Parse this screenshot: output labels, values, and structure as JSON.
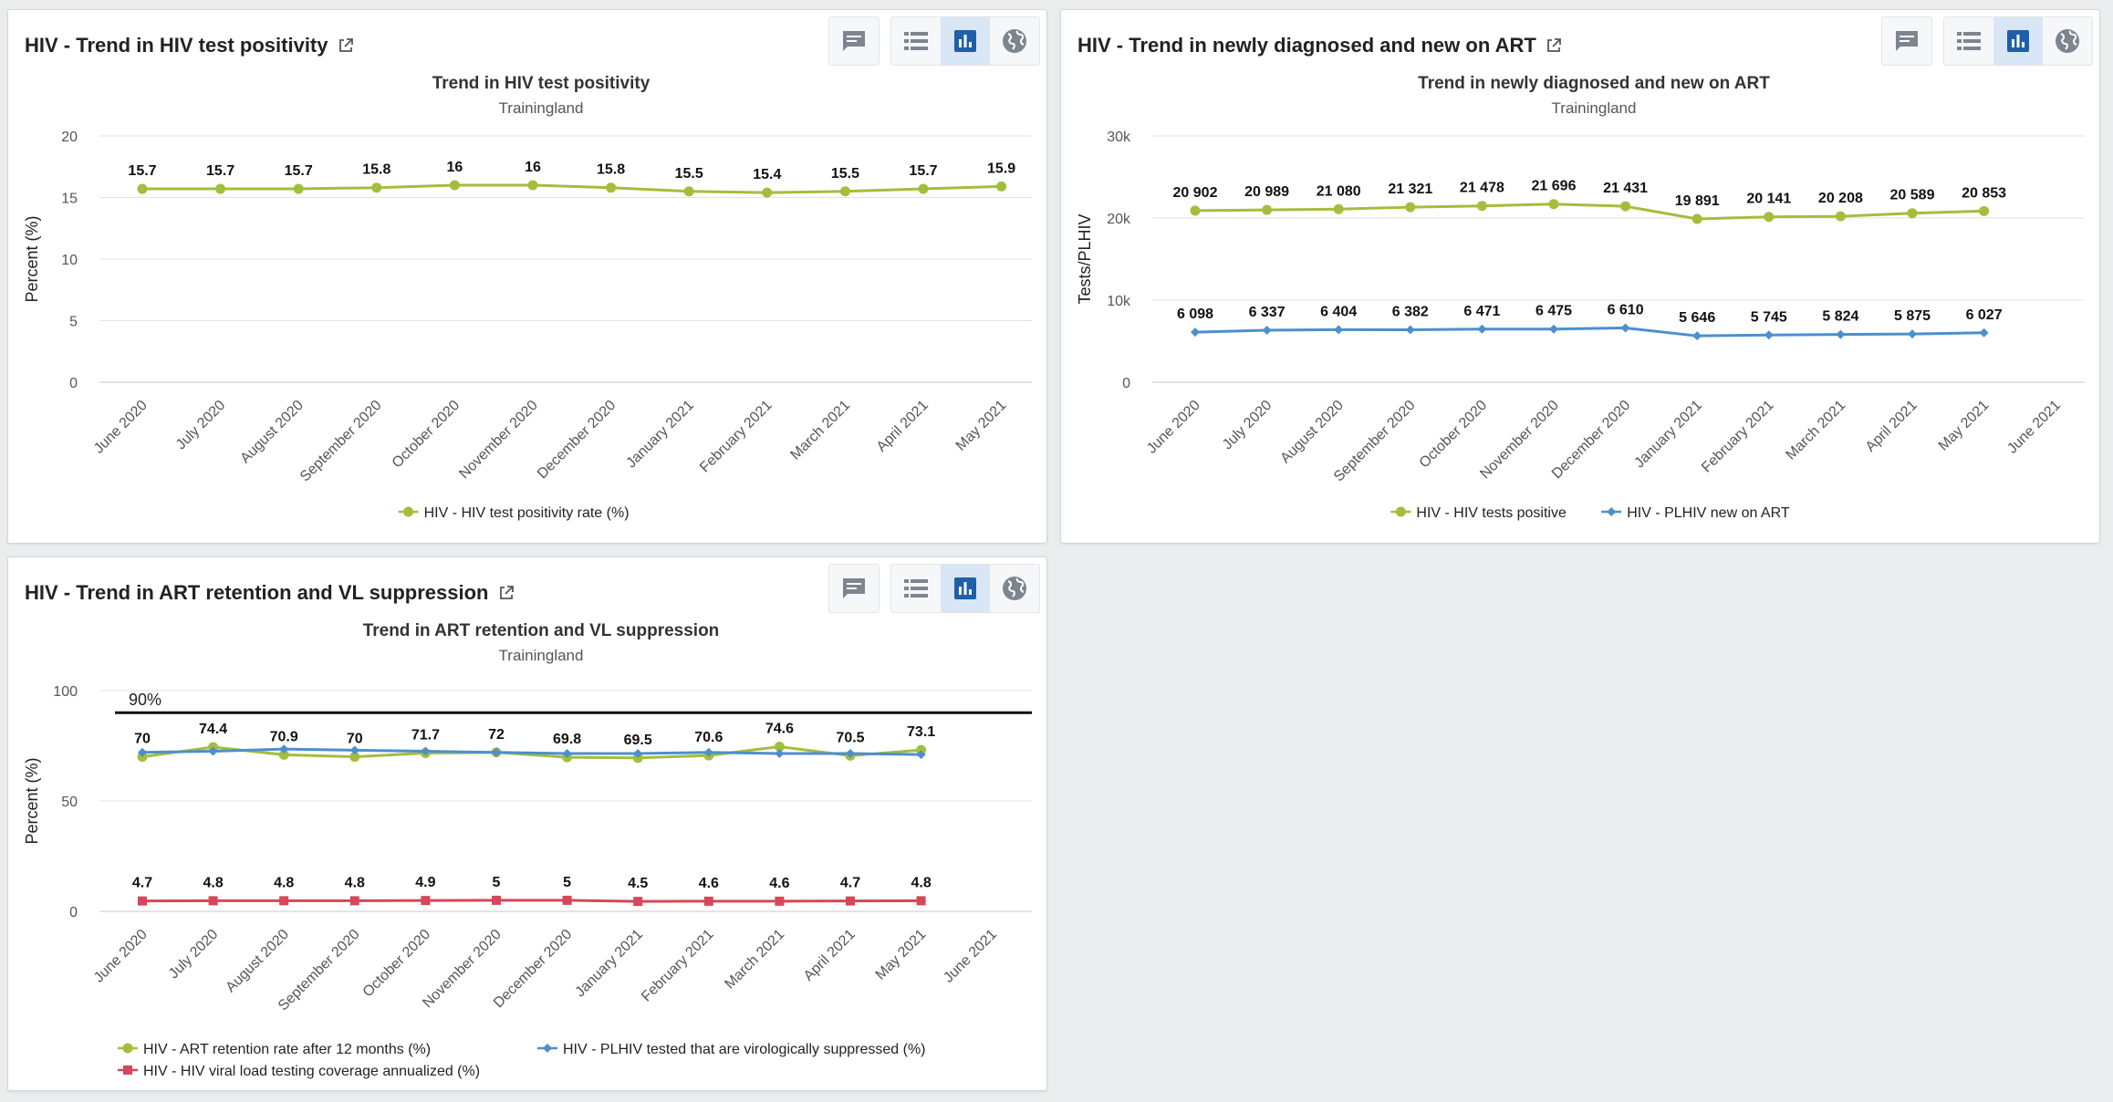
{
  "icons": {
    "interpretation": "comment-icon",
    "table": "list-icon",
    "chart": "bar-chart-icon",
    "map": "globe-icon",
    "open": "external-link-icon"
  },
  "colors": {
    "green": "#a3be3c",
    "blue": "#4d8fcd",
    "red": "#d5475a",
    "active_button": "#d9e6f5",
    "active_icon": "#1f5fa8"
  },
  "cards": [
    {
      "title": "HIV - Trend in HIV test positivity",
      "chart_data": {
        "type": "line",
        "title": "Trend in HIV test positivity",
        "subtitle": "Trainingland",
        "ylabel": "Percent (%)",
        "ylim": [
          0,
          20
        ],
        "yticks": [
          "0",
          "5",
          "10",
          "15",
          "20"
        ],
        "yticks_values": [
          0,
          5,
          10,
          15,
          20
        ],
        "categories": [
          "June 2020",
          "July 2020",
          "August 2020",
          "September 2020",
          "October 2020",
          "November 2020",
          "December 2020",
          "January 2021",
          "February 2021",
          "March 2021",
          "April 2021",
          "May 2021"
        ],
        "series": [
          {
            "name": "HIV - HIV test positivity rate (%)",
            "color": "#a3be3c",
            "marker": "circle",
            "values": [
              15.7,
              15.7,
              15.7,
              15.8,
              16,
              16,
              15.8,
              15.5,
              15.4,
              15.5,
              15.7,
              15.9
            ],
            "labels": [
              "15.7",
              "15.7",
              "15.7",
              "15.8",
              "16",
              "16",
              "15.8",
              "15.5",
              "15.4",
              "15.5",
              "15.7",
              "15.9"
            ]
          }
        ],
        "legend": "bottom-center",
        "grid": true
      }
    },
    {
      "title": "HIV - Trend in newly diagnosed and new on ART",
      "chart_data": {
        "type": "line",
        "title": "Trend in newly diagnosed and new on ART",
        "subtitle": "Trainingland",
        "ylabel": "Tests/PLHIV",
        "ylim": [
          0,
          30000
        ],
        "yticks": [
          "0",
          "10k",
          "20k",
          "30k"
        ],
        "yticks_values": [
          0,
          10000,
          20000,
          30000
        ],
        "categories": [
          "June 2020",
          "July 2020",
          "August 2020",
          "September 2020",
          "October 2020",
          "November 2020",
          "December 2020",
          "January 2021",
          "February 2021",
          "March 2021",
          "April 2021",
          "May 2021",
          "June 2021"
        ],
        "series": [
          {
            "name": "HIV - HIV tests positive",
            "color": "#a3be3c",
            "marker": "circle",
            "values": [
              20902,
              20989,
              21080,
              21321,
              21478,
              21696,
              21431,
              19891,
              20141,
              20208,
              20589,
              20853
            ],
            "labels": [
              "20 902",
              "20 989",
              "21 080",
              "21 321",
              "21 478",
              "21 696",
              "21 431",
              "19 891",
              "20 141",
              "20 208",
              "20 589",
              "20 853"
            ]
          },
          {
            "name": "HIV - PLHIV new on ART",
            "color": "#4d8fcd",
            "marker": "diamond",
            "values": [
              6098,
              6337,
              6404,
              6382,
              6471,
              6475,
              6610,
              5646,
              5745,
              5824,
              5875,
              6027
            ],
            "labels": [
              "6 098",
              "6 337",
              "6 404",
              "6 382",
              "6 471",
              "6 475",
              "6 610",
              "5 646",
              "5 745",
              "5 824",
              "5 875",
              "6 027"
            ]
          }
        ],
        "legend": "bottom-center",
        "grid": true
      }
    },
    {
      "title": "HIV - Trend in ART retention and VL suppression",
      "chart_data": {
        "type": "line",
        "title": "Trend in ART retention and VL suppression",
        "subtitle": "Trainingland",
        "ylabel": "Percent (%)",
        "ylim": [
          0,
          100
        ],
        "yticks": [
          "0",
          "50",
          "100"
        ],
        "yticks_values": [
          0,
          50,
          100
        ],
        "target_line": {
          "value": 90,
          "label": "90%"
        },
        "categories": [
          "June 2020",
          "July 2020",
          "August 2020",
          "September 2020",
          "October 2020",
          "November 2020",
          "December 2020",
          "January 2021",
          "February 2021",
          "March 2021",
          "April 2021",
          "May 2021",
          "June 2021"
        ],
        "series": [
          {
            "name": "HIV - ART retention rate after 12 months (%)",
            "color": "#a3be3c",
            "marker": "circle",
            "values": [
              70,
              74.4,
              70.9,
              70,
              71.7,
              72,
              69.8,
              69.5,
              70.6,
              74.6,
              70.5,
              73.1
            ],
            "labels": [
              "70",
              "74.4",
              "70.9",
              "70",
              "71.7",
              "72",
              "69.8",
              "69.5",
              "70.6",
              "74.6",
              "70.5",
              "73.1"
            ]
          },
          {
            "name": "HIV - PLHIV tested that are virologically suppressed (%)",
            "color": "#4d8fcd",
            "marker": "diamond",
            "values": [
              72,
              72.5,
              73.5,
              73,
              72.5,
              72,
              71.5,
              71.5,
              72,
              71.5,
              71.5,
              71
            ],
            "labels": []
          },
          {
            "name": "HIV - HIV viral load testing coverage annualized (%)",
            "color": "#d5475a",
            "marker": "square",
            "values": [
              4.7,
              4.8,
              4.8,
              4.8,
              4.9,
              5,
              5,
              4.5,
              4.6,
              4.6,
              4.7,
              4.8
            ],
            "labels": [
              "4.7",
              "4.8",
              "4.8",
              "4.8",
              "4.9",
              "5",
              "5",
              "4.5",
              "4.6",
              "4.6",
              "4.7",
              "4.8"
            ]
          }
        ],
        "legend": "bottom-left",
        "grid": true
      }
    }
  ]
}
